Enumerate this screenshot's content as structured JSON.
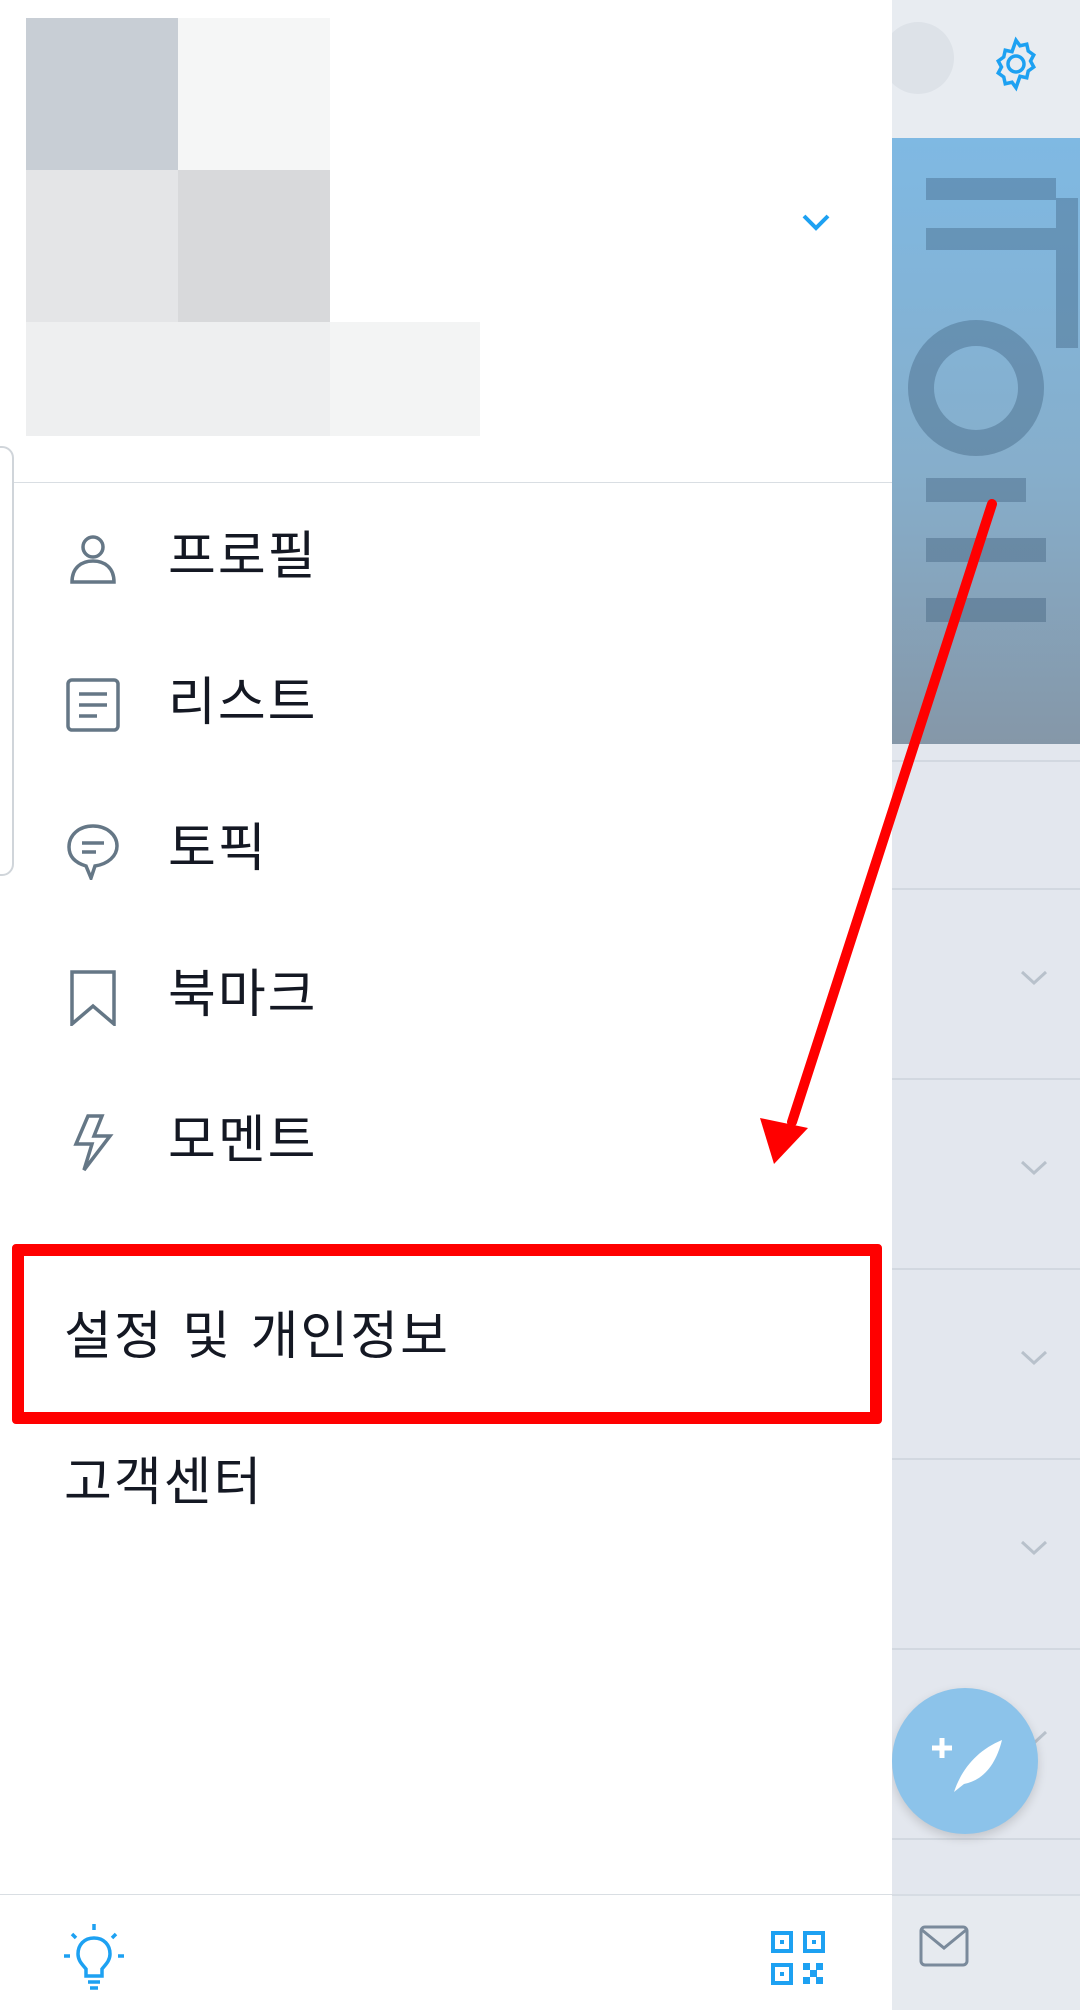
{
  "menu": {
    "items": [
      {
        "label": "프로필",
        "icon": "person-icon"
      },
      {
        "label": "리스트",
        "icon": "list-icon"
      },
      {
        "label": "토픽",
        "icon": "topic-icon"
      },
      {
        "label": "북마크",
        "icon": "bookmark-icon"
      },
      {
        "label": "모멘트",
        "icon": "lightning-icon"
      }
    ]
  },
  "settings": {
    "settings_privacy_label": "설정 및 개인정보",
    "help_center_label": "고객센터"
  },
  "footer": {
    "left_icon": "lightbulb-icon",
    "right_icon": "qr-code-icon"
  },
  "colors": {
    "accent": "#1da1f2",
    "annotation": "#ff0000",
    "text": "#141823",
    "icon_gray": "#657786"
  }
}
